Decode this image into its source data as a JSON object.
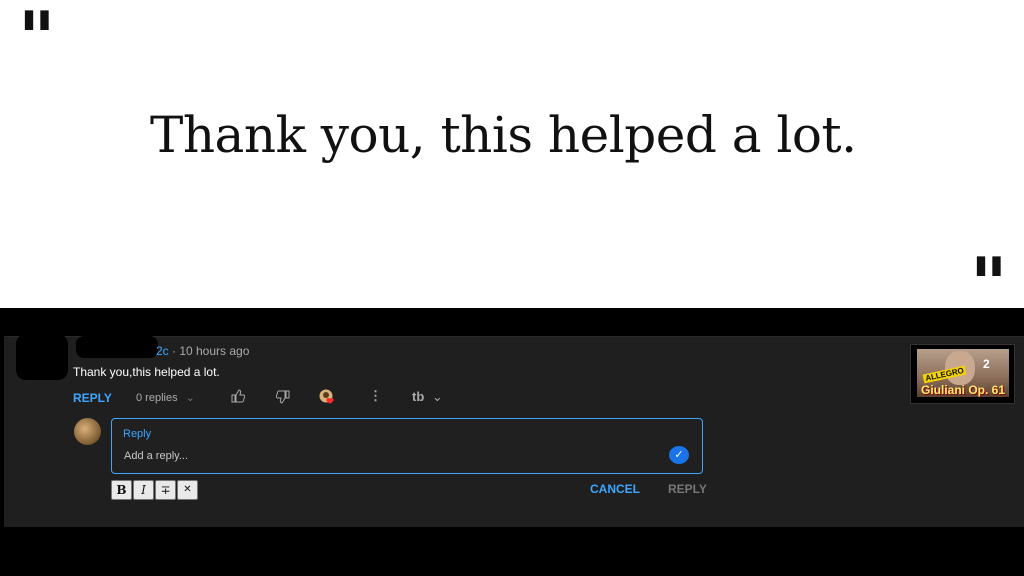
{
  "quote": {
    "open_mark": "\"",
    "close_mark": "\"",
    "text": "Thank you, this helped a lot."
  },
  "comment": {
    "author_visible_suffix": "2c",
    "meta": "· 10 hours ago",
    "text": "Thank you,this helped a lot."
  },
  "actions": {
    "reply_label": "REPLY",
    "replies_label": "0 replies",
    "like_icon": "thumbs-up-icon",
    "dislike_icon": "thumbs-down-icon",
    "heart_icon": "creator-heart-icon",
    "more_icon": "more-vert-icon",
    "tb_label": "tb"
  },
  "reply_box": {
    "label": "Reply",
    "placeholder": "Add a reply...",
    "value": ""
  },
  "format_buttons": [
    "B",
    "I",
    "∓",
    "✕"
  ],
  "buttons": {
    "cancel": "CANCEL",
    "reply": "REPLY"
  },
  "thumbnail": {
    "badge": "ALLEGRO",
    "title": "Giuliani Op. 61",
    "number": "2"
  },
  "colors": {
    "accent": "#3ea6ff",
    "panel_bg": "#1f1f1f",
    "disabled": "#777777"
  }
}
